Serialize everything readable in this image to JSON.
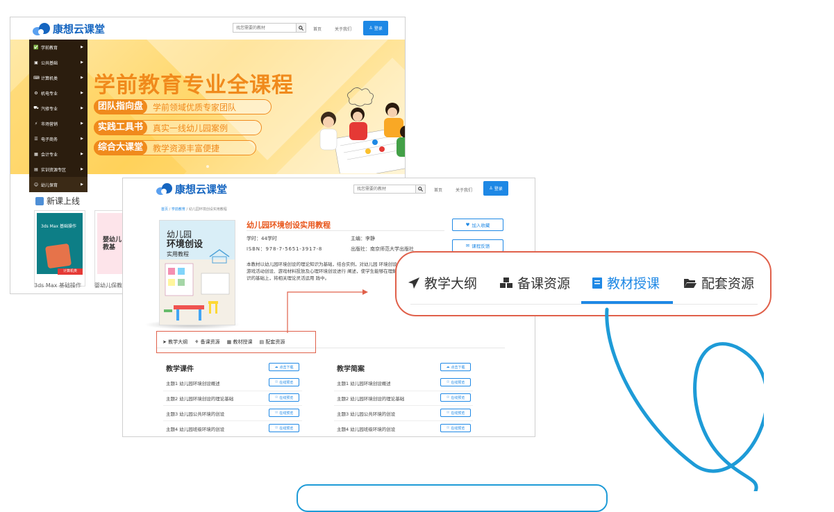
{
  "brand": {
    "name": "康想云课堂"
  },
  "header": {
    "search_placeholder": "找您需要的教材",
    "nav_home": "首页",
    "nav_about": "关于我们",
    "login_label": "登录"
  },
  "sidebar": {
    "items": [
      {
        "label": "学前教育",
        "icon": "trophy-icon"
      },
      {
        "label": "公共基础",
        "icon": "bank-icon"
      },
      {
        "label": "计算机类",
        "icon": "keyboard-icon"
      },
      {
        "label": "机电专业",
        "icon": "cog-icon"
      },
      {
        "label": "汽修专业",
        "icon": "car-icon"
      },
      {
        "label": "市场营销",
        "icon": "bolt-icon"
      },
      {
        "label": "电子商务",
        "icon": "cart-icon"
      },
      {
        "label": "会计专业",
        "icon": "money-icon"
      },
      {
        "label": "实训资源专区",
        "icon": "briefcase-icon"
      },
      {
        "label": "幼儿保育",
        "icon": "child-icon"
      }
    ]
  },
  "banner": {
    "title": "学前教育专业全课程",
    "pills": [
      {
        "tag": "团队指向盘",
        "text": "学前领域优质专家团队"
      },
      {
        "tag": "实践工具书",
        "text": "真实一线幼儿园案例"
      },
      {
        "tag": "综合大课堂",
        "text": "教学资源丰富便捷"
      }
    ]
  },
  "new_courses": {
    "heading": "新课上线",
    "books": [
      {
        "caption": "3ds Max 基础操作",
        "cover_text": "3ds Max 基础操作",
        "badge": "计算机类"
      },
      {
        "caption": "婴幼儿保教",
        "cover_text": "婴幼儿 保教基"
      }
    ]
  },
  "detail": {
    "breadcrumb": [
      "首页",
      "学前教育",
      "幼儿园环境创设实用教程"
    ],
    "title": "幼儿园环境创设实用教程",
    "hours": "学时：44学时",
    "editor": "主编：李静",
    "isbn": "ISBN：978-7-5651-3917-8",
    "publisher": "出版社：南京师范大学出版社",
    "description": "本教材以幼儿园环境创设的理论知识为基础，结合实例，对幼儿园 环境创设、游戏活动创设、游戏材料投放及心理环境创设进行 阐述，使学生能够在理解知识的基础上，将相关理论灵活运用 践中。",
    "fav_button": "加入收藏",
    "feedback_button": "课程反馈",
    "cover": {
      "line1": "幼儿园",
      "line2": "环境创设",
      "line3": "实用教程"
    },
    "tabs": [
      {
        "label": "教学大纲",
        "icon": "paper-plane-icon"
      },
      {
        "label": "备课资源",
        "icon": "cubes-icon"
      },
      {
        "label": "教材授课",
        "icon": "book-icon"
      },
      {
        "label": "配套资源",
        "icon": "folder-open-icon"
      }
    ],
    "active_tab": "教材授课",
    "sections": {
      "left": {
        "heading": "教学课件",
        "download": "点击下载",
        "rows": [
          "主题1 幼儿园环境创设概述",
          "主题2 幼儿园环境创设的理论基础",
          "主题3 幼儿园公共环境的创设",
          "主题4 幼儿园班级环境的创设"
        ]
      },
      "right": {
        "heading": "教学简案",
        "download": "点击下载",
        "rows": [
          "主题1 幼儿园环境创设概述",
          "主题2 幼儿园环境创设的理论基础",
          "主题3 幼儿园公共环境的创设",
          "主题4 幼儿园班级环境的创设"
        ]
      },
      "preview": "在线预览"
    }
  },
  "colors": {
    "primary": "#1e88e5",
    "accent_orange": "#f08a1c",
    "highlight_red": "#e0604a",
    "title_red": "#e8551a",
    "sidebar_bg": "#2b1d0e",
    "callout_blue": "#1e9bd7"
  }
}
